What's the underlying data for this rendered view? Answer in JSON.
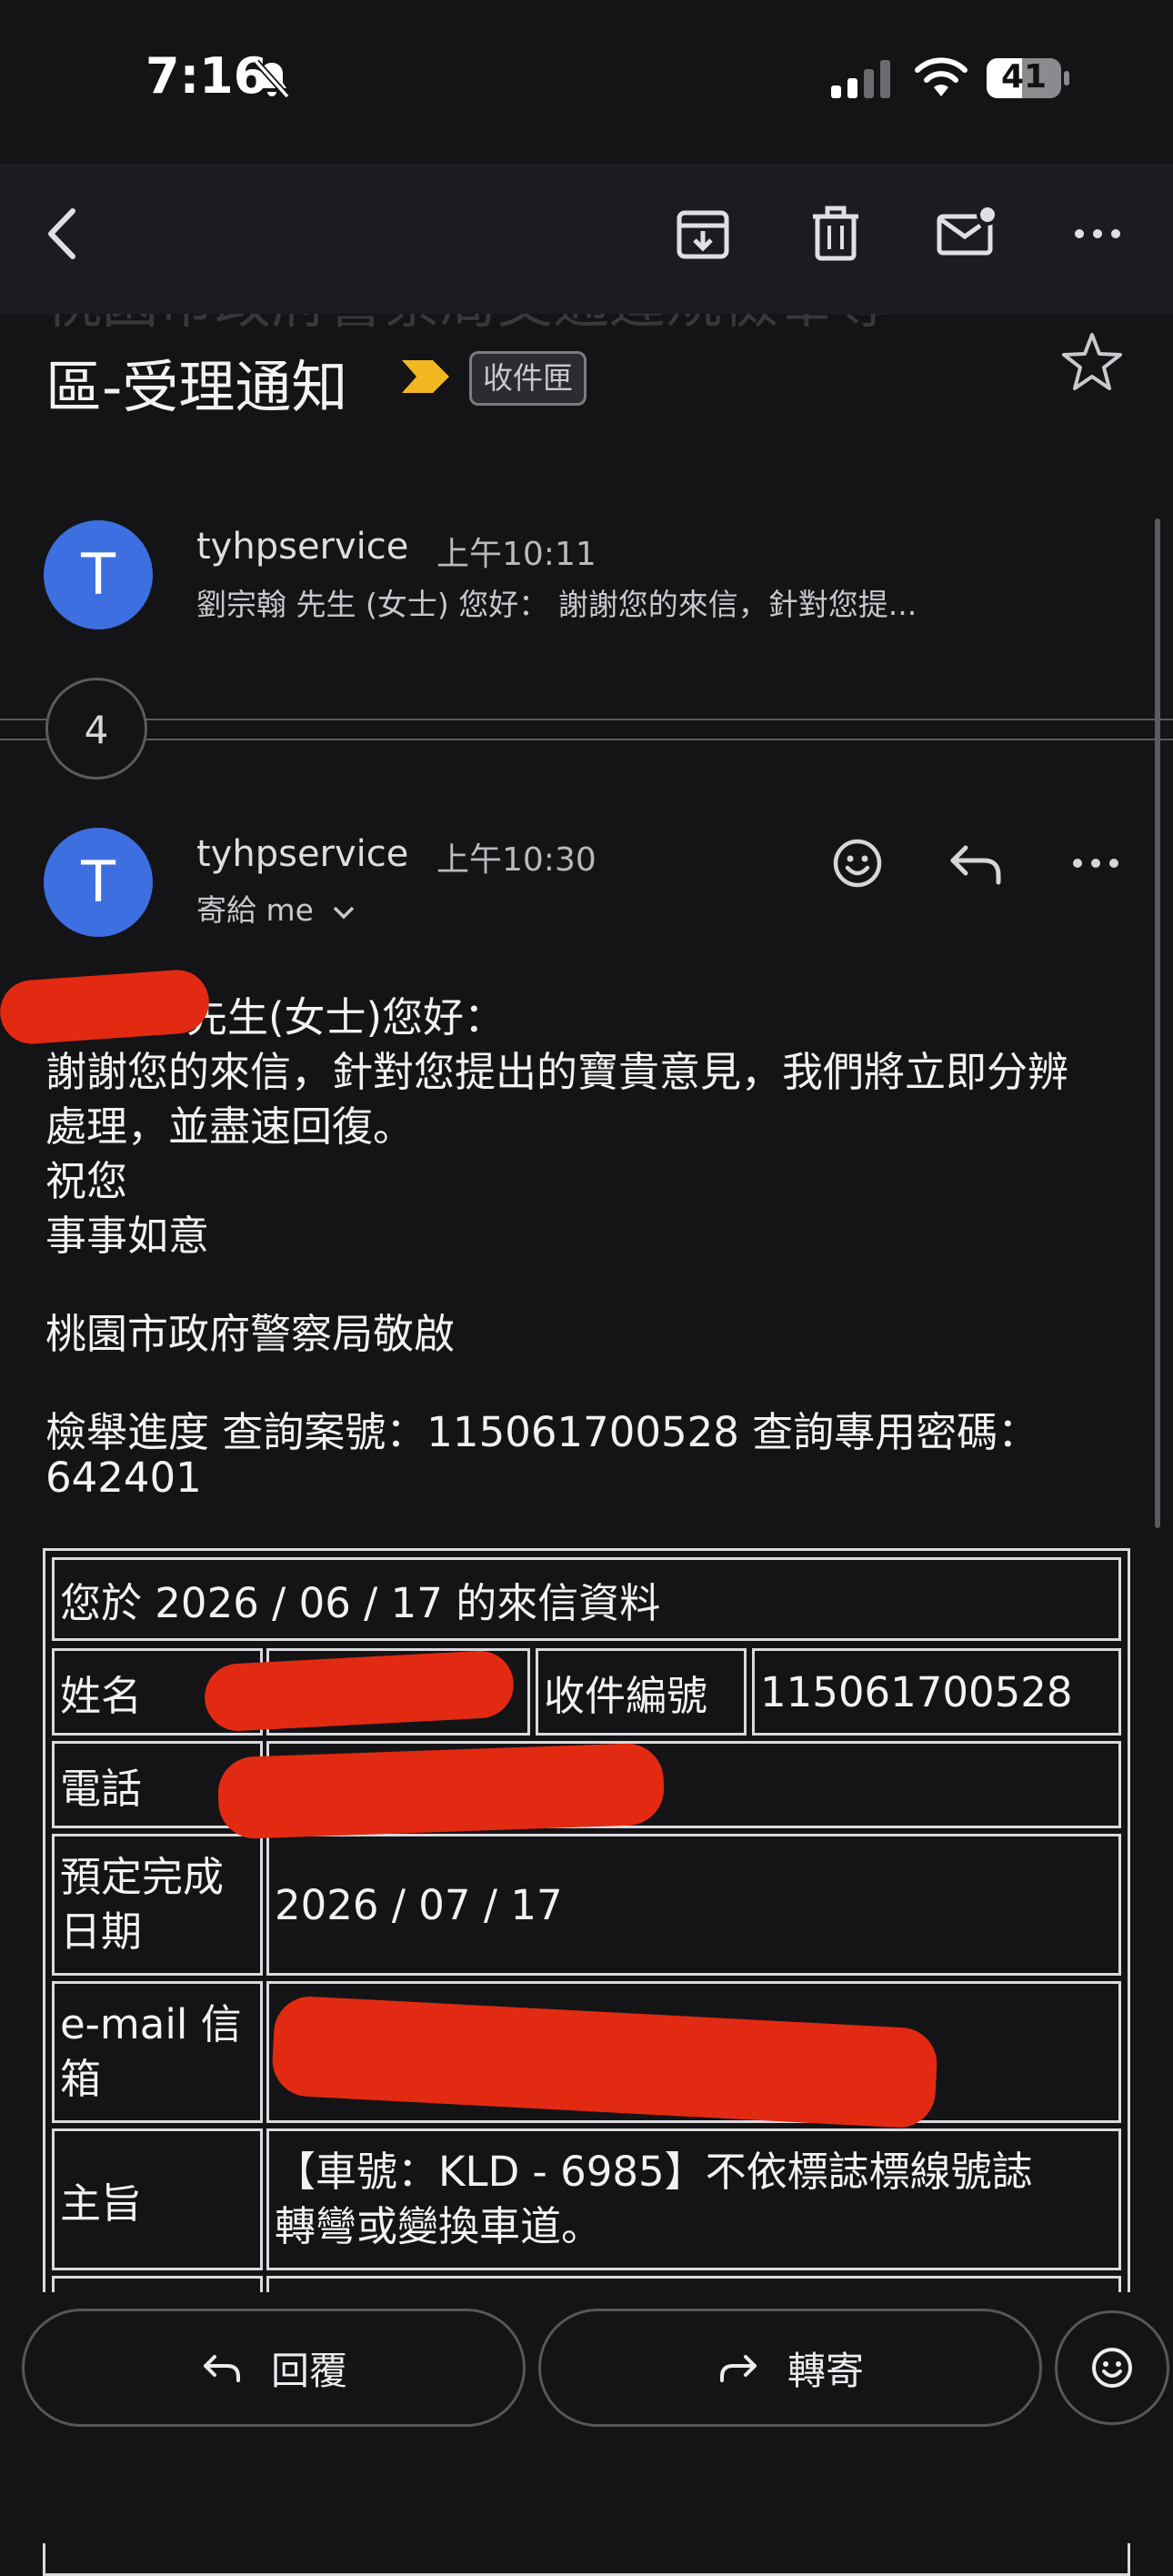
{
  "status_bar": {
    "time": "7:16",
    "battery": "41"
  },
  "toolbar": {
    "back": "back-icon",
    "archive": "archive-icon",
    "delete": "trash-icon",
    "mark_unread": "mail-unread-icon",
    "more": "more-icon"
  },
  "email": {
    "subject_line1": "桃園市政府警察局交通違規檢舉專",
    "subject_line2": "區-受理通知",
    "label": "收件匣"
  },
  "thread": {
    "first": {
      "avatar": "T",
      "sender": "tyhpservice",
      "time": "上午10:11",
      "snippet": "劉宗翰 先生 (女士) 您好：  謝謝您的來信，針對您提..."
    },
    "collapsed_count": "4",
    "latest": {
      "avatar": "T",
      "sender": "tyhpservice",
      "time": "上午10:30",
      "to": "寄給 me"
    }
  },
  "message": {
    "greeting": "先生(女士)您好：",
    "line1": "謝謝您的來信，針對您提出的寶貴意見，我們將立即分辨",
    "line2": "處理，並盡速回復。",
    "line3": "祝您",
    "line4": "事事如意",
    "signature": "桃園市政府警察局敬啟",
    "progress_line1": "檢舉進度 查詢案號：115061700528 查詢專用密碼：",
    "progress_line2": "642401"
  },
  "table": {
    "header": "您於 2026 / 06 / 17 的來信資料",
    "name_label": "姓名",
    "receipt_label": "收件編號",
    "receipt_value": "115061700528",
    "phone_label": "電話",
    "due_label_1": "預定完成",
    "due_label_2": "日期",
    "due_value": "2026 / 07 / 17",
    "email_label_1": "e-mail 信",
    "email_label_2": "箱",
    "subject_label": "主旨",
    "subject_value_1": "【車號：KLD - 6985】不依標誌標線號誌",
    "subject_value_2": "轉彎或變換車道。"
  },
  "actions": {
    "reply": "回覆",
    "forward": "轉寄"
  }
}
